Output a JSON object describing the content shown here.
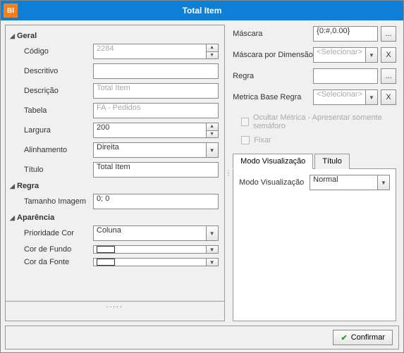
{
  "window": {
    "title": "Total  Item",
    "app_icon_text": "BI"
  },
  "left": {
    "sections": {
      "geral": {
        "header": "Geral",
        "codigo": {
          "label": "Código",
          "value": "2284"
        },
        "descritivo": {
          "label": "Descritivo",
          "value": ""
        },
        "descricao": {
          "label": "Descrição",
          "value": "Total  Item"
        },
        "tabela": {
          "label": "Tabela",
          "value": "FA - Pedidos"
        },
        "largura": {
          "label": "Largura",
          "value": "200"
        },
        "alinhamento": {
          "label": "Alinhamento",
          "value": "Direita"
        },
        "titulo": {
          "label": "Título",
          "value": "Total  Item"
        }
      },
      "regra": {
        "header": "Regra",
        "tamanho_imagem": {
          "label": "Tamanho Imagem",
          "value": "0; 0"
        }
      },
      "aparencia": {
        "header": "Aparência",
        "prioridade_cor": {
          "label": "Prioridade Cor",
          "value": "Coluna"
        },
        "cor_fundo": {
          "label": "Cor de Fundo",
          "value": "#ffffff"
        },
        "cor_fonte": {
          "label": "Cor da Fonte",
          "value": "#ffffff"
        }
      }
    }
  },
  "right": {
    "mascara": {
      "label": "Máscara",
      "value": "{0:#,0.00}"
    },
    "mascara_dim": {
      "label": "Máscara por Dimensão",
      "placeholder": "<Selecionar>"
    },
    "regra": {
      "label": "Regra",
      "value": ""
    },
    "metrica_base": {
      "label": "Metrica Base Regra",
      "placeholder": "<Selecionar>"
    },
    "chk_ocultar": {
      "label": "Ocultar Métrica - Apresentar somente semáforo"
    },
    "chk_fixar": {
      "label": "Fixar"
    },
    "tabs": {
      "t1": "Modo Visualização",
      "t2": "Título"
    },
    "tab_content": {
      "modo_vis": {
        "label": "Modo Visualização",
        "value": "Normal"
      }
    },
    "buttons": {
      "more": "...",
      "clear": "X"
    }
  },
  "footer": {
    "confirm": "Confirmar"
  }
}
